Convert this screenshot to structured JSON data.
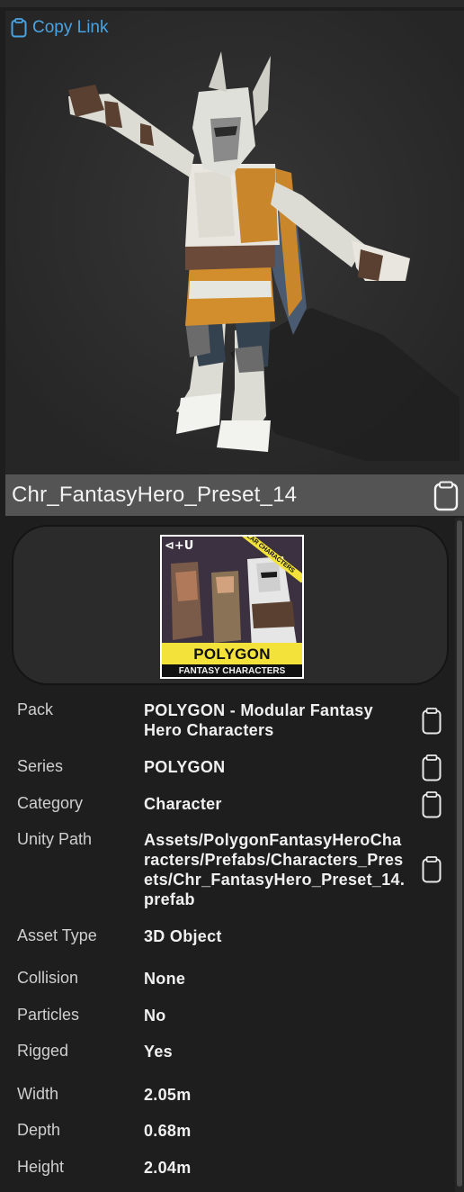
{
  "viewport": {
    "copy_link_label": "Copy Link"
  },
  "asset_title": "Chr_FantasyHero_Preset_14",
  "pack_cover": {
    "logo_text": "⊲+U",
    "ribbon": "MODULAR CHARACTERS",
    "title": "POLYGON",
    "subtitle": "FANTASY CHARACTERS"
  },
  "properties": [
    {
      "key": "Pack",
      "value": "POLYGON - Modular Fantasy Hero Characters",
      "copyable": true
    },
    {
      "key": "Series",
      "value": "POLYGON",
      "copyable": true
    },
    {
      "key": "Category",
      "value": "Character",
      "copyable": true
    },
    {
      "key": "Unity Path",
      "value": "Assets/PolygonFantasyHeroCharacters/Prefabs/Characters_Presets/Chr_FantasyHero_Preset_14.prefab",
      "copyable": true
    },
    {
      "key": "Asset Type",
      "value": "3D Object",
      "copyable": false
    },
    {
      "key": "Collision",
      "value": "None",
      "copyable": false
    },
    {
      "key": "Particles",
      "value": "No",
      "copyable": false
    },
    {
      "key": "Rigged",
      "value": "Yes",
      "copyable": false
    },
    {
      "key": "Width",
      "value": "2.05m",
      "copyable": false
    },
    {
      "key": "Depth",
      "value": "0.68m",
      "copyable": false
    },
    {
      "key": "Height",
      "value": "2.04m",
      "copyable": false
    }
  ],
  "colors": {
    "accent": "#4aa3e0",
    "background": "#1e1e1e",
    "title_bar": "#545454"
  },
  "icons": {
    "copy": "clipboard-icon"
  }
}
